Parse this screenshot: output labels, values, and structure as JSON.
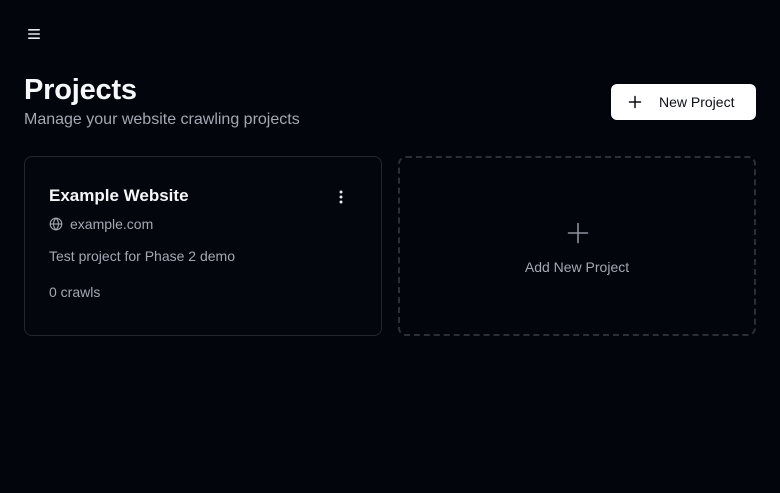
{
  "header": {
    "menu_icon": "hamburger-menu-icon",
    "title": "Projects",
    "subtitle": "Manage your website crawling projects",
    "new_project_label": "New Project",
    "new_project_icon": "plus-icon"
  },
  "projects": [
    {
      "name": "Example Website",
      "domain": "example.com",
      "description": "Test project for Phase 2 demo",
      "crawls": "0 crawls",
      "menu_icon": "more-vertical-icon",
      "domain_icon": "globe-icon"
    }
  ],
  "add_project": {
    "label": "Add New Project",
    "icon": "plus-icon"
  },
  "colors": {
    "background": "#03050c",
    "card_border": "#23262e",
    "muted_text": "#a3a8b3",
    "primary_button_bg": "#ffffff"
  }
}
